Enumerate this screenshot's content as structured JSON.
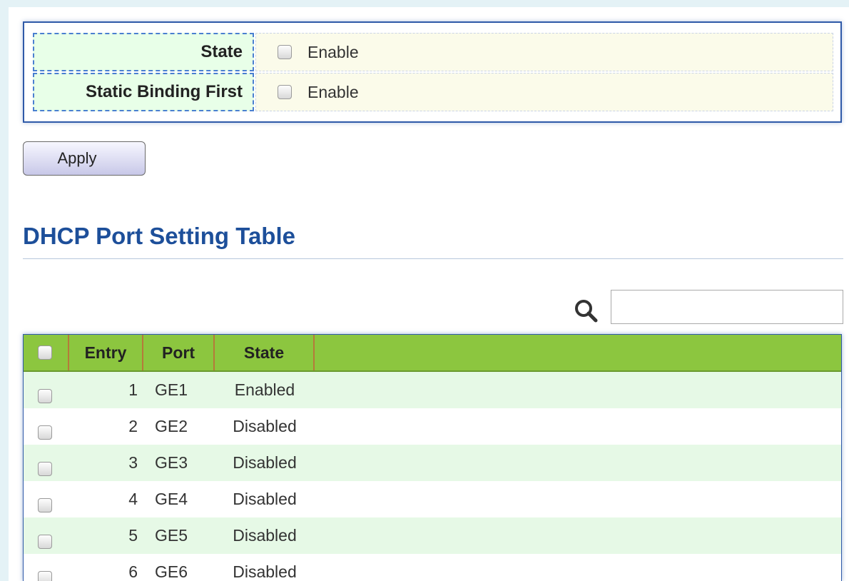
{
  "settings": {
    "rows": [
      {
        "label": "State",
        "value_label": "Enable",
        "checked": false
      },
      {
        "label": "Static Binding First",
        "value_label": "Enable",
        "checked": false
      }
    ],
    "apply_label": "Apply"
  },
  "section": {
    "title": "DHCP Port Setting Table"
  },
  "search": {
    "placeholder": "",
    "value": "",
    "icon": "search-icon"
  },
  "table": {
    "headers": {
      "entry": "Entry",
      "port": "Port",
      "state": "State"
    },
    "rows": [
      {
        "entry": "1",
        "port": "GE1",
        "state": "Enabled"
      },
      {
        "entry": "2",
        "port": "GE2",
        "state": "Disabled"
      },
      {
        "entry": "3",
        "port": "GE3",
        "state": "Disabled"
      },
      {
        "entry": "4",
        "port": "GE4",
        "state": "Disabled"
      },
      {
        "entry": "5",
        "port": "GE5",
        "state": "Disabled"
      },
      {
        "entry": "6",
        "port": "GE6",
        "state": "Disabled"
      }
    ]
  },
  "colors": {
    "accent": "#1d4f9a",
    "header_green": "#8cc63f",
    "row_green": "#e6f9e6"
  }
}
